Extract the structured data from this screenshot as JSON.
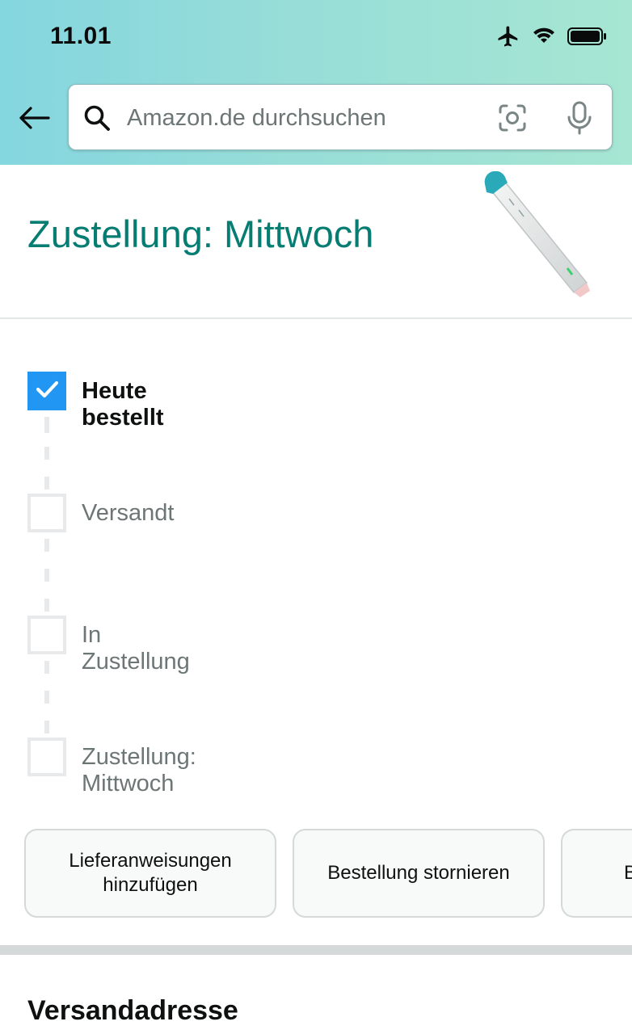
{
  "status_bar": {
    "time": "11.01",
    "icons": [
      "airplane-icon",
      "wifi-icon",
      "battery-icon"
    ]
  },
  "search": {
    "placeholder": "Amazon.de durchsuchen",
    "icons": [
      "search-icon",
      "camera-icon",
      "microphone-icon"
    ]
  },
  "delivery": {
    "title": "Zustellung: Mittwoch",
    "title_color": "#067d72"
  },
  "tracking": {
    "steps": [
      {
        "label": "Heute bestellt",
        "checked": true
      },
      {
        "label": "Versandt",
        "checked": false
      },
      {
        "label": "In Zustellung",
        "checked": false
      },
      {
        "label": "Zustellung: Mittwoch",
        "checked": false
      }
    ],
    "checked_color": "#2196f3"
  },
  "actions": [
    {
      "label": "Lieferanweisungen\nhinzufügen"
    },
    {
      "label": "Bestellung stornieren"
    },
    {
      "label": "B"
    }
  ],
  "shipping": {
    "title": "Versandadresse"
  }
}
